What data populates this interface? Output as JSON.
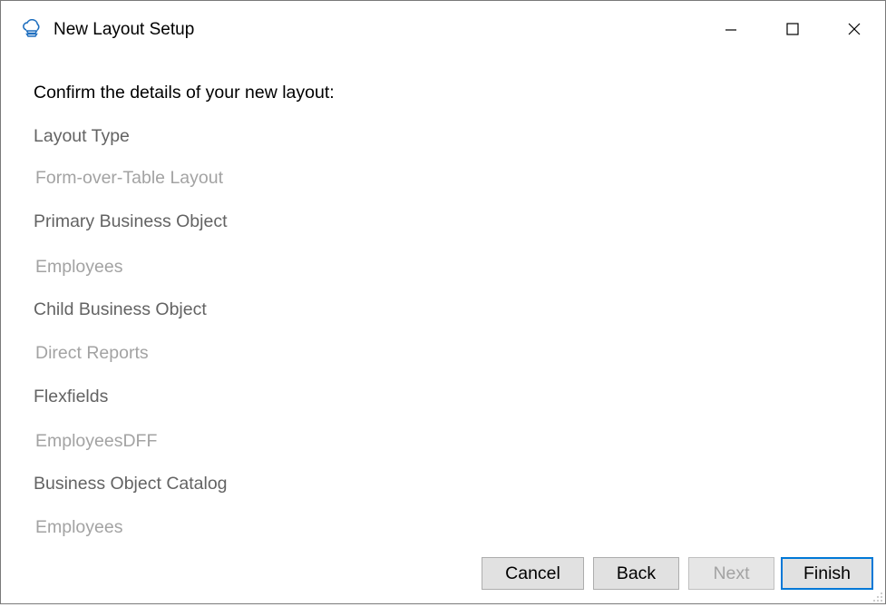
{
  "window": {
    "title": "New Layout Setup",
    "icon": "cloud-stack-icon"
  },
  "title_controls": {
    "minimize": "minimize-icon",
    "maximize": "maximize-icon",
    "close": "close-icon"
  },
  "heading": "Confirm the details of your new layout:",
  "details": [
    {
      "label": "Layout Type",
      "value": "Form-over-Table Layout"
    },
    {
      "label": "Primary Business Object",
      "value": "Employees"
    },
    {
      "label": "Child Business Object",
      "value": "Direct Reports"
    },
    {
      "label": "Flexfields",
      "value": "EmployeesDFF"
    },
    {
      "label": "Business Object Catalog",
      "value": "Employees"
    }
  ],
  "buttons": {
    "cancel": "Cancel",
    "back": "Back",
    "next": "Next",
    "finish": "Finish"
  },
  "colors": {
    "label_text": "#636363",
    "value_text": "#a3a3a3",
    "focus_border": "#0078d7",
    "icon_blue": "#1f6fbf"
  }
}
